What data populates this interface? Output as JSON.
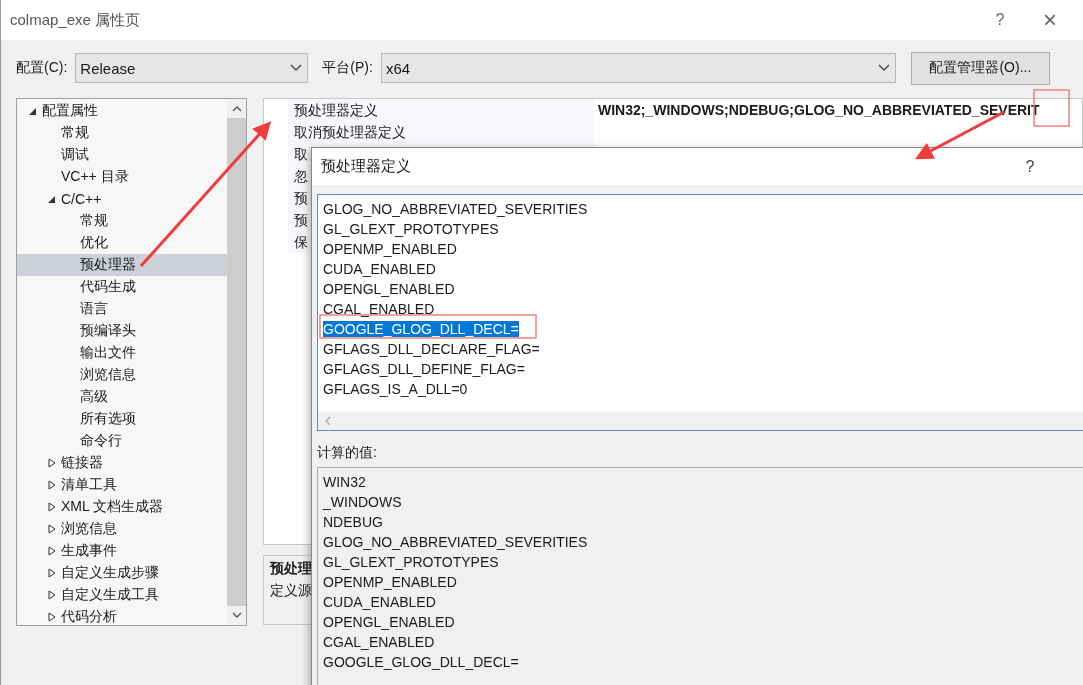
{
  "window": {
    "title": "colmap_exe 属性页",
    "help": "?",
    "close": "×"
  },
  "config_bar": {
    "config_label": "配置(C):",
    "config_value": "Release",
    "platform_label": "平台(P):",
    "platform_value": "x64",
    "manager_button": "配置管理器(O)..."
  },
  "tree": [
    {
      "label": "配置属性",
      "expanded": true,
      "selected": false,
      "children": [
        {
          "label": "常规",
          "selected": false
        },
        {
          "label": "调试",
          "selected": false
        },
        {
          "label": "VC++ 目录",
          "selected": false
        },
        {
          "label": "C/C++",
          "expanded": true,
          "selected": false,
          "children": [
            {
              "label": "常规",
              "selected": false
            },
            {
              "label": "优化",
              "selected": false
            },
            {
              "label": "预处理器",
              "selected": true
            },
            {
              "label": "代码生成",
              "selected": false
            },
            {
              "label": "语言",
              "selected": false
            },
            {
              "label": "预编译头",
              "selected": false
            },
            {
              "label": "输出文件",
              "selected": false
            },
            {
              "label": "浏览信息",
              "selected": false
            },
            {
              "label": "高级",
              "selected": false
            },
            {
              "label": "所有选项",
              "selected": false
            },
            {
              "label": "命令行",
              "selected": false
            }
          ]
        },
        {
          "label": "链接器",
          "expanded": false,
          "selected": false
        },
        {
          "label": "清单工具",
          "expanded": false,
          "selected": false
        },
        {
          "label": "XML 文档生成器",
          "expanded": false,
          "selected": false
        },
        {
          "label": "浏览信息",
          "expanded": false,
          "selected": false
        },
        {
          "label": "生成事件",
          "expanded": false,
          "selected": false
        },
        {
          "label": "自定义生成步骤",
          "expanded": false,
          "selected": false
        },
        {
          "label": "自定义生成工具",
          "expanded": false,
          "selected": false
        },
        {
          "label": "代码分析",
          "expanded": false,
          "selected": false
        }
      ]
    }
  ],
  "properties": [
    {
      "name": "预处理器定义",
      "value": "WIN32;_WINDOWS;NDEBUG;GLOG_NO_ABBREVIATED_SEVERIT"
    },
    {
      "name": "取消预处理器定义"
    },
    {
      "name": "取"
    },
    {
      "name": "忽"
    },
    {
      "name": "预"
    },
    {
      "name": "预"
    },
    {
      "name": "保"
    }
  ],
  "description": {
    "title": "预处理",
    "text": "定义源"
  },
  "dialog": {
    "title": "预处理器定义",
    "help": "?",
    "definitions": [
      {
        "text": "GLOG_NO_ABBREVIATED_SEVERITIES",
        "selected": false
      },
      {
        "text": "GL_GLEXT_PROTOTYPES",
        "selected": false
      },
      {
        "text": "OPENMP_ENABLED",
        "selected": false
      },
      {
        "text": "CUDA_ENABLED",
        "selected": false
      },
      {
        "text": "OPENGL_ENABLED",
        "selected": false
      },
      {
        "text": "CGAL_ENABLED",
        "selected": false
      },
      {
        "text": "GOOGLE_GLOG_DLL_DECL=",
        "selected": true
      },
      {
        "text": "GFLAGS_DLL_DECLARE_FLAG=",
        "selected": false
      },
      {
        "text": "GFLAGS_DLL_DEFINE_FLAG=",
        "selected": false
      },
      {
        "text": "GFLAGS_IS_A_DLL=0",
        "selected": false
      }
    ],
    "computed_label": "计算的值:",
    "computed": [
      "WIN32",
      "_WINDOWS",
      "NDEBUG",
      "GLOG_NO_ABBREVIATED_SEVERITIES",
      "GL_GLEXT_PROTOTYPES",
      "OPENMP_ENABLED",
      "CUDA_ENABLED",
      "OPENGL_ENABLED",
      "CGAL_ENABLED",
      "GOOGLE_GLOG_DLL_DECL="
    ]
  }
}
